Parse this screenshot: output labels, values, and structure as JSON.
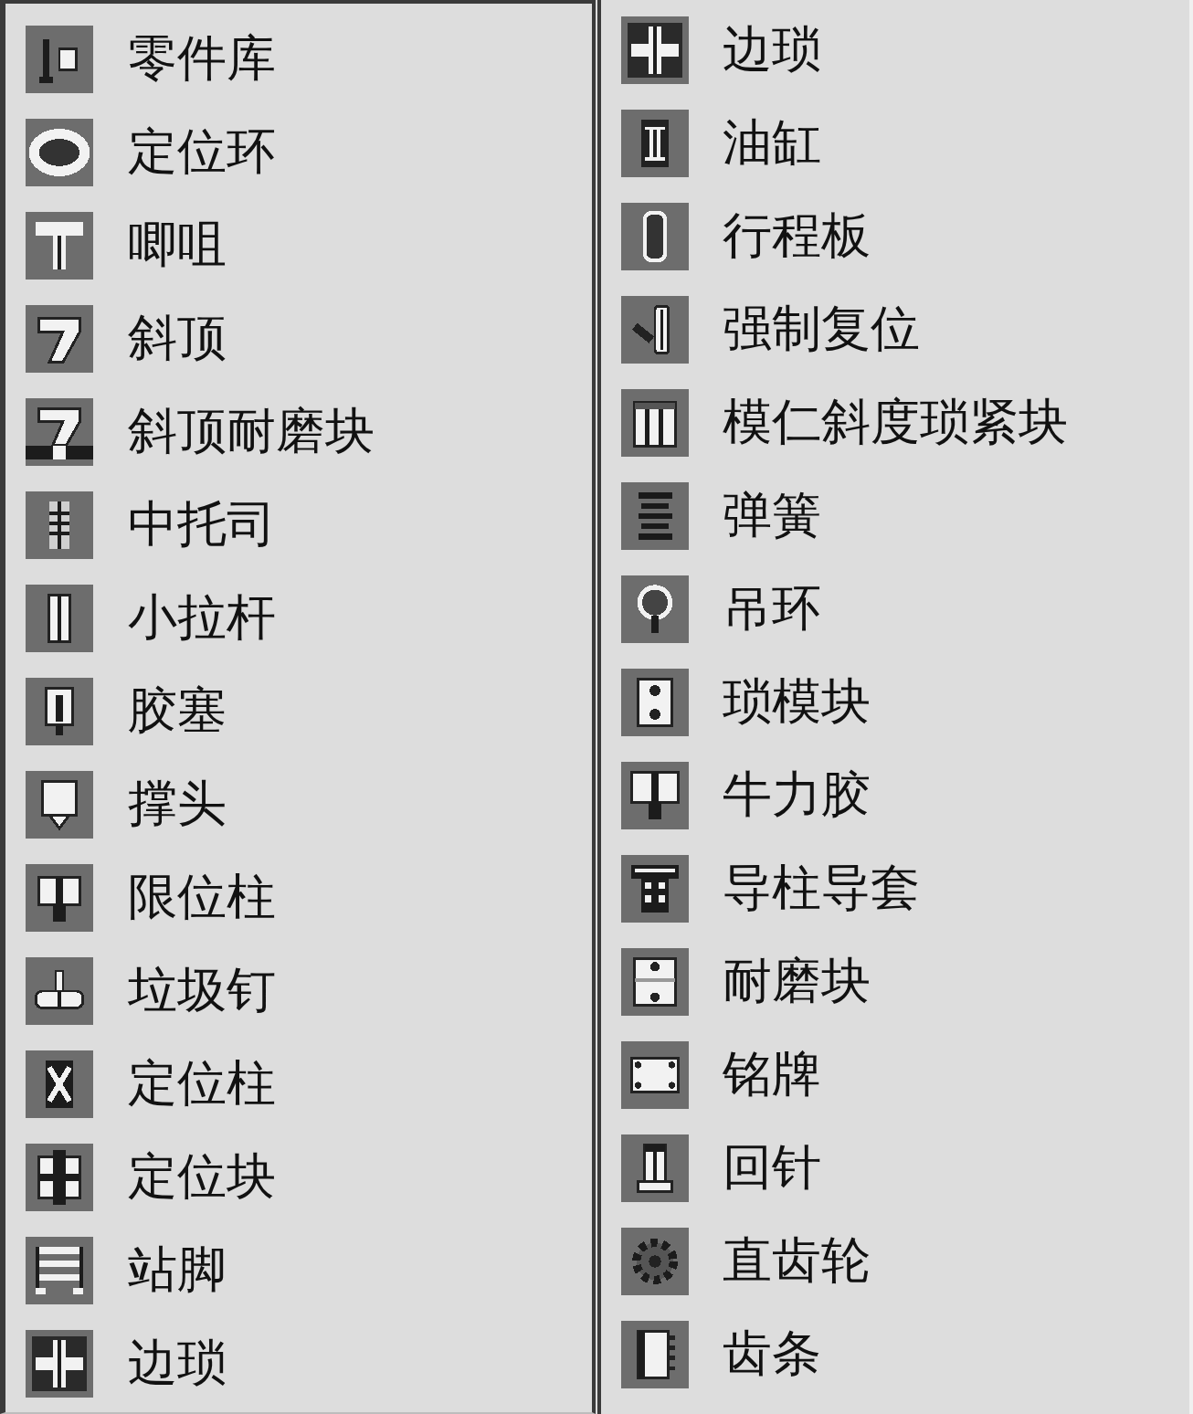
{
  "panels": [
    {
      "items": [
        {
          "label": "零件库"
        },
        {
          "label": "定位环"
        },
        {
          "label": "唧咀"
        },
        {
          "label": "斜顶"
        },
        {
          "label": "斜顶耐磨块"
        },
        {
          "label": "中托司"
        },
        {
          "label": "小拉杆"
        },
        {
          "label": "胶塞"
        },
        {
          "label": "撑头"
        },
        {
          "label": "限位柱"
        },
        {
          "label": "垃圾钉"
        },
        {
          "label": "定位柱"
        },
        {
          "label": "定位块"
        },
        {
          "label": "站脚"
        },
        {
          "label": "边琐"
        }
      ]
    },
    {
      "items": [
        {
          "label": "边琐"
        },
        {
          "label": "油缸"
        },
        {
          "label": "行程板"
        },
        {
          "label": "强制复位"
        },
        {
          "label": "模仁斜度琐紧块"
        },
        {
          "label": "弹簧"
        },
        {
          "label": "吊环"
        },
        {
          "label": "琐模块"
        },
        {
          "label": "牛力胶"
        },
        {
          "label": "导柱导套"
        },
        {
          "label": "耐磨块"
        },
        {
          "label": "铭牌"
        },
        {
          "label": "回针"
        },
        {
          "label": "直齿轮"
        },
        {
          "label": "齿条"
        }
      ]
    }
  ]
}
